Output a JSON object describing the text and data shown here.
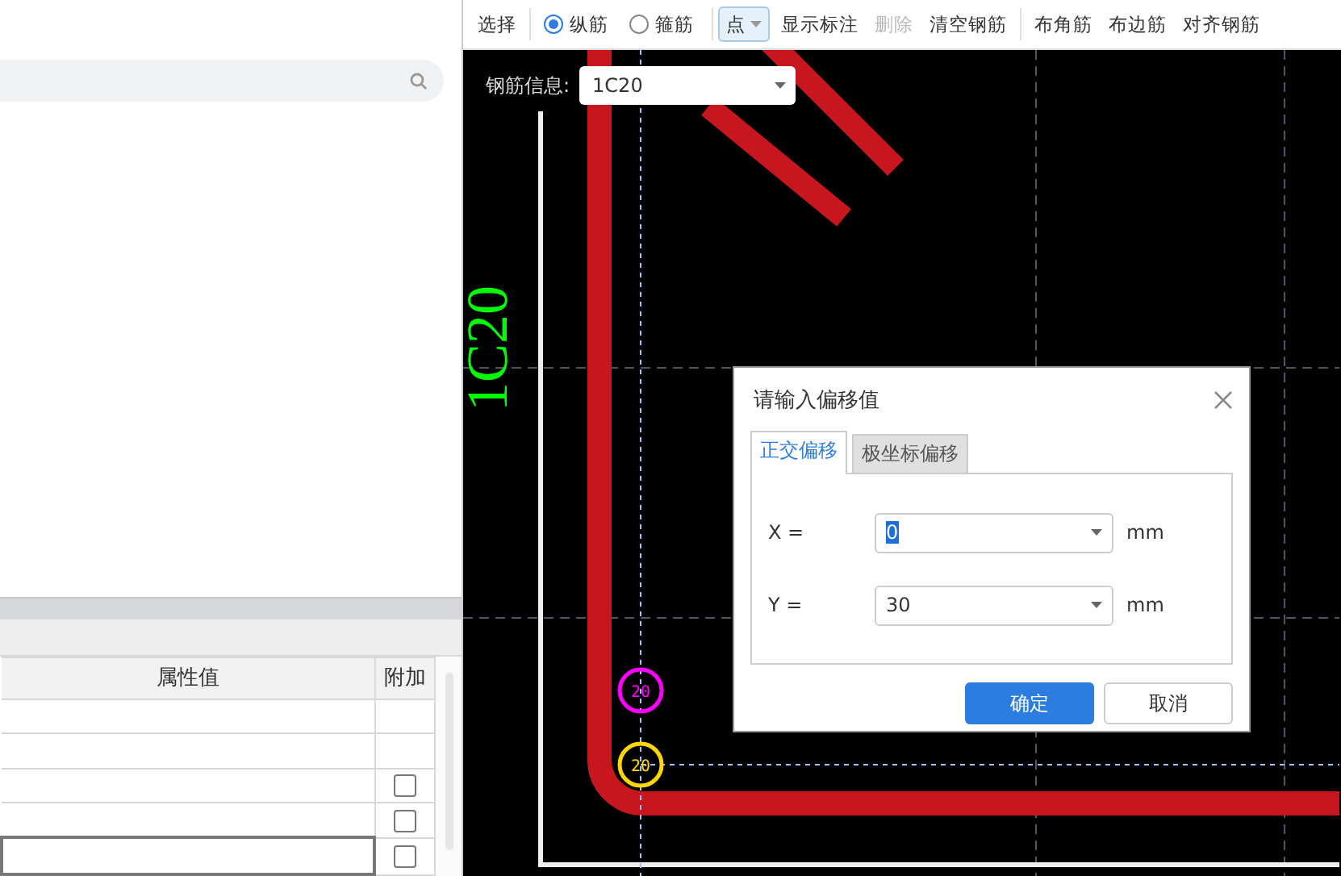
{
  "left_panel": {
    "table": {
      "columns": [
        "属性值",
        "附加"
      ],
      "rows": [
        {
          "kind": "plain",
          "selected": false
        },
        {
          "kind": "plain",
          "selected": false
        },
        {
          "kind": "checkbox",
          "checked": false,
          "selected": false
        },
        {
          "kind": "checkbox",
          "checked": false,
          "selected": false
        },
        {
          "kind": "checkbox",
          "checked": false,
          "selected": true
        }
      ]
    }
  },
  "toolbar": [
    {
      "kind": "button",
      "label": "选择",
      "disabled": false
    },
    {
      "kind": "separator"
    },
    {
      "kind": "radio",
      "label": "纵筋",
      "selected": true
    },
    {
      "kind": "radio",
      "label": "箍筋",
      "selected": false
    },
    {
      "kind": "separator"
    },
    {
      "kind": "dropdown",
      "label": "点"
    },
    {
      "kind": "button",
      "label": "显示标注",
      "disabled": false
    },
    {
      "kind": "button",
      "label": "删除",
      "disabled": true
    },
    {
      "kind": "button",
      "label": "清空钢筋",
      "disabled": false
    },
    {
      "kind": "separator"
    },
    {
      "kind": "button",
      "label": "布角筋",
      "disabled": false
    },
    {
      "kind": "button",
      "label": "布边筋",
      "disabled": false
    },
    {
      "kind": "button",
      "label": "对齐钢筋",
      "disabled": false
    }
  ],
  "canvas": {
    "rebar_info": {
      "label": "钢筋信息:",
      "value": "1C20"
    },
    "annotation": "1C20",
    "markers": [
      {
        "label": "20",
        "color": "#ff00ff"
      },
      {
        "label": "20",
        "color": "#ffd700"
      }
    ]
  },
  "dialog": {
    "title": "请输入偏移值",
    "tabs": [
      {
        "label": "正交偏移",
        "selected": true
      },
      {
        "label": "极坐标偏移",
        "selected": false
      }
    ],
    "fields": [
      {
        "label": "X =",
        "value": "0",
        "text_selected": true,
        "unit": "mm"
      },
      {
        "label": "Y =",
        "value": "30",
        "text_selected": false,
        "unit": "mm"
      }
    ],
    "buttons": [
      {
        "label": "确定",
        "kind": "primary"
      },
      {
        "label": "取消",
        "kind": "default"
      }
    ]
  }
}
